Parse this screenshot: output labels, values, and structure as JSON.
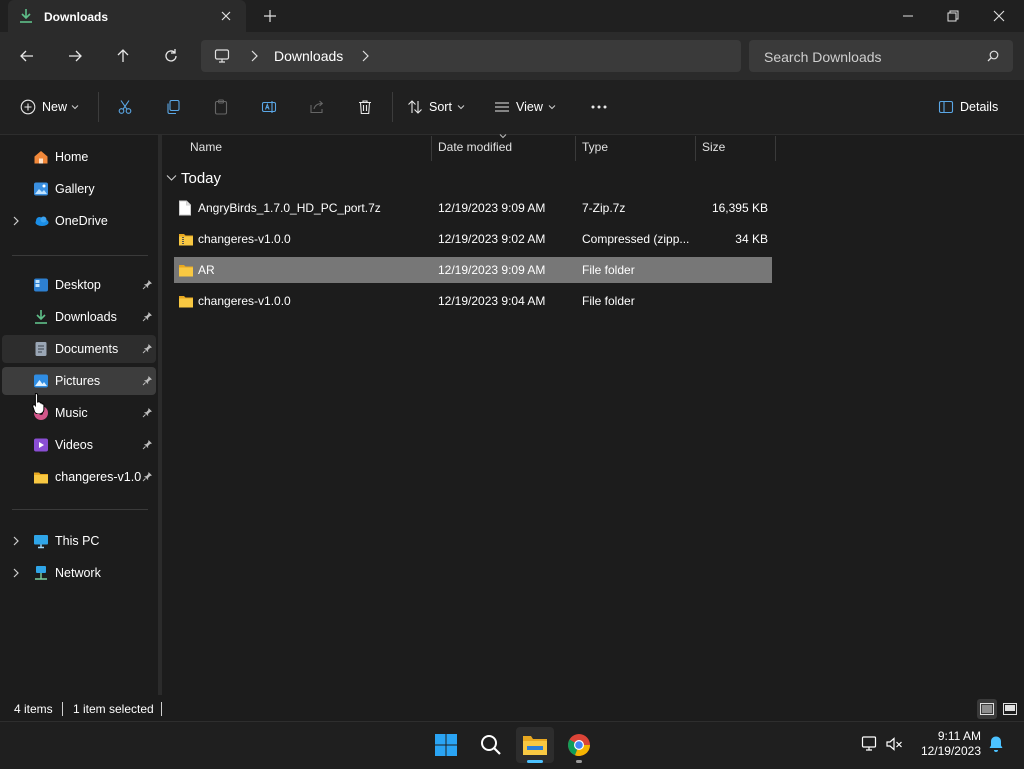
{
  "window": {
    "tab_title": "Downloads",
    "controls": {
      "minimize": "minimize",
      "maximize": "restore",
      "close": "close"
    }
  },
  "nav": {
    "breadcrumb": [
      "Downloads"
    ],
    "search_placeholder": "Search Downloads"
  },
  "toolbar": {
    "new_label": "New",
    "sort_label": "Sort",
    "view_label": "View",
    "details_label": "Details"
  },
  "sidebar": {
    "items": [
      {
        "label": "Home",
        "icon": "home-icon"
      },
      {
        "label": "Gallery",
        "icon": "gallery-icon"
      },
      {
        "label": "OneDrive",
        "icon": "onedrive-icon"
      },
      {
        "label": "Desktop",
        "icon": "desktop-icon",
        "pinned": true
      },
      {
        "label": "Downloads",
        "icon": "downloads-icon",
        "pinned": true
      },
      {
        "label": "Documents",
        "icon": "documents-icon",
        "pinned": true
      },
      {
        "label": "Pictures",
        "icon": "pictures-icon",
        "pinned": true
      },
      {
        "label": "Music",
        "icon": "music-icon",
        "pinned": true
      },
      {
        "label": "Videos",
        "icon": "videos-icon",
        "pinned": true
      },
      {
        "label": "changeres-v1.0.0",
        "icon": "folder-icon",
        "pinned": true
      },
      {
        "label": "This PC",
        "icon": "this-pc-icon"
      },
      {
        "label": "Network",
        "icon": "network-icon"
      }
    ]
  },
  "list": {
    "columns": [
      "Name",
      "Date modified",
      "Type",
      "Size"
    ],
    "group": "Today",
    "rows": [
      {
        "name": "AngryBirds_1.7.0_HD_PC_port.7z",
        "date": "12/19/2023 9:09 AM",
        "type": "7-Zip.7z",
        "size": "16,395 KB",
        "icon": "file-icon"
      },
      {
        "name": "changeres-v1.0.0",
        "date": "12/19/2023 9:02 AM",
        "type": "Compressed (zipp...",
        "size": "34 KB",
        "icon": "zip-folder-icon"
      },
      {
        "name": "AR",
        "date": "12/19/2023 9:09 AM",
        "type": "File folder",
        "size": "",
        "icon": "folder-icon",
        "selected": true
      },
      {
        "name": "changeres-v1.0.0",
        "date": "12/19/2023 9:04 AM",
        "type": "File folder",
        "size": "",
        "icon": "folder-icon"
      }
    ]
  },
  "status": {
    "item_count": "4 items",
    "selection": "1 item selected"
  },
  "taskbar": {
    "time": "9:11 AM",
    "date": "12/19/2023"
  },
  "colors": {
    "accent": "#0078d4",
    "folder": "#f8c842",
    "selection": "#777777"
  }
}
